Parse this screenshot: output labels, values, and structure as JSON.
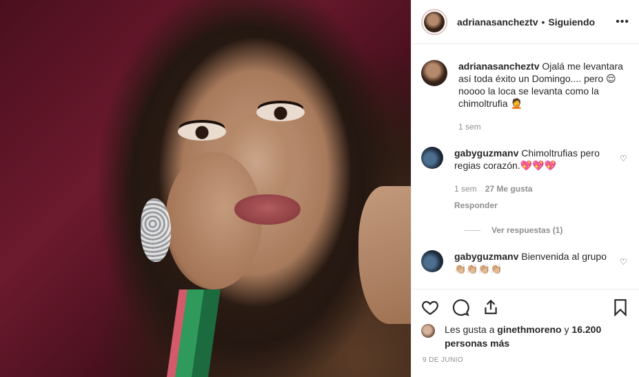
{
  "post": {
    "username": "adrianasancheztv",
    "separator": "•",
    "follow_status": "Siguiendo",
    "more": "•••"
  },
  "caption": {
    "username": "adrianasancheztv",
    "text": "Ojalá me levantara así toda éxito un Domingo.... pero 😌 noooo la loca se levanta como la chimoltrufia 🤦",
    "time": "1 sem"
  },
  "comments": [
    {
      "username": "gabyguzmanv",
      "text": "Chimoltrufias pero regias corazón.💖💖💖",
      "time": "1 sem",
      "likes": "27 Me gusta",
      "reply": "Responder",
      "heart": "♡"
    },
    {
      "username": "gabyguzmanv",
      "text": "Bienvenida al grupo 👏🏼👏🏼👏🏼👏🏼",
      "heart": "♡"
    }
  ],
  "view_replies": "Ver respuestas (1)",
  "likes": {
    "prefix": "Les gusta a ",
    "user": "ginethmoreno",
    "middle": " y ",
    "count": "16.200 personas más"
  },
  "date": "9 DE JUNIO",
  "icons": [
    "heart-icon",
    "comment-icon",
    "share-icon",
    "bookmark-icon"
  ]
}
